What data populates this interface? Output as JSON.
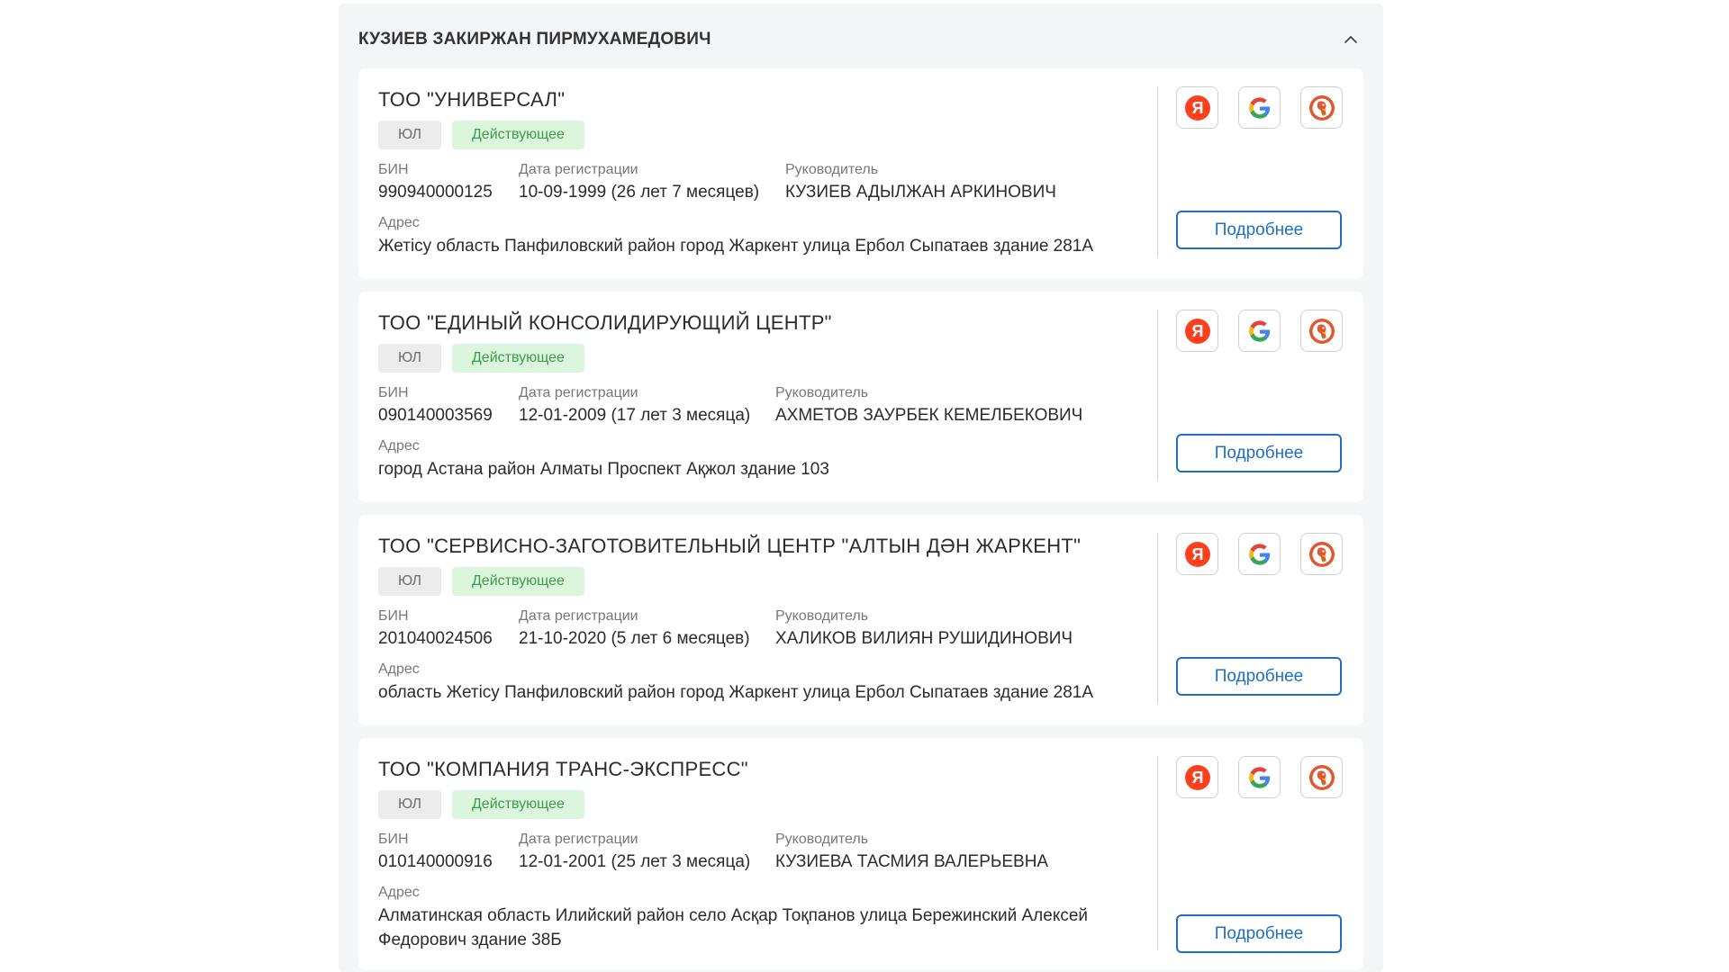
{
  "person": {
    "name": "КУЗИЕВ ЗАКИРЖАН ПИРМУХАМЕДОВИЧ"
  },
  "labels": {
    "bin": "БИН",
    "reg_date": "Дата регистрации",
    "director": "Руководитель",
    "address": "Адрес",
    "more_button": "Подробнее"
  },
  "search_icons": [
    "yandex-icon",
    "google-icon",
    "duckduckgo-icon"
  ],
  "colors": {
    "accent": "#1f6fc4",
    "status_bg": "#dcf5dd",
    "status_text": "#3d9b4b",
    "yandex": "#fc3f1d",
    "duckduckgo": "#de5833"
  },
  "companies": [
    {
      "title": "ТОО \"УНИВЕРСАЛ\"",
      "type": "ЮЛ",
      "status": "Действующее",
      "bin": "990940000125",
      "reg_date": "10-09-1999 (26 лет 7 месяцев)",
      "director": "КУЗИЕВ АДЫЛЖАН АРКИНОВИЧ",
      "address": "Жетісу область Панфиловский район город Жаркент улица Ербол Сыпатаев здание 281А"
    },
    {
      "title": "ТОО \"ЕДИНЫЙ КОНСОЛИДИРУЮЩИЙ ЦЕНТР\"",
      "type": "ЮЛ",
      "status": "Действующее",
      "bin": "090140003569",
      "reg_date": "12-01-2009 (17 лет 3 месяца)",
      "director": "АХМЕТОВ ЗАУРБЕК КЕМЕЛБЕКОВИЧ",
      "address": "город Астана район Алматы Проспект Ақжол здание 103"
    },
    {
      "title": "ТОО \"СЕРВИСНО-ЗАГОТОВИТЕЛЬНЫЙ ЦЕНТР \"АЛТЫН ДӘН ЖАРКЕНТ\"",
      "type": "ЮЛ",
      "status": "Действующее",
      "bin": "201040024506",
      "reg_date": "21-10-2020 (5 лет 6 месяцев)",
      "director": "ХАЛИКОВ ВИЛИЯН РУШИДИНОВИЧ",
      "address": "область Жетісу Панфиловский район город Жаркент улица Ербол Сыпатаев здание 281А"
    },
    {
      "title": "ТОО \"КОМПАНИЯ ТРАНС-ЭКСПРЕСС\"",
      "type": "ЮЛ",
      "status": "Действующее",
      "bin": "010140000916",
      "reg_date": "12-01-2001 (25 лет 3 месяца)",
      "director": "КУЗИЕВА ТАСМИЯ ВАЛЕРЬЕВНА",
      "address": "Алматинская область Илийский район село Асқар Тоқпанов улица Бережинский Алексей Федорович здание 38Б"
    }
  ]
}
